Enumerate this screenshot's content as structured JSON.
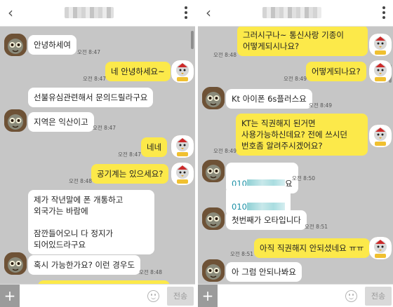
{
  "left": {
    "messages": [
      {
        "text": "안녕하세여"
      },
      {
        "text": "네 안녕하세요~"
      },
      {
        "text": "선불유심관련해서 문의드릴라구요"
      },
      {
        "text": "지역은 익산이고"
      },
      {
        "text": "네네"
      },
      {
        "text": "공기계는 있으세요?"
      },
      {
        "text": "제가 작년말에 폰 개통하고\n외국가는 바람에\n\n잠깐들어오니 다 정지가\n되어있드라구요"
      },
      {
        "text": "혹시 가능한가요? 이런 경우도"
      }
    ],
    "times": [
      "오전 8:47",
      "오전 8:47",
      "오전 8:47",
      "오전 8:47",
      "오전 8:48",
      "오전 8:48"
    ]
  },
  "right": {
    "messages": [
      {
        "text": "그러시구나~ 통신사랑 기종이\n어떻게되시나요?"
      },
      {
        "text": "어떻게되나요?"
      },
      {
        "text": "Kt 아이폰 6s플러스요"
      },
      {
        "text": "KT는 직권해지 된거면\n사용가능하신데요? 전에 쓰시던\n번호좀 알려주시겠어요?"
      },
      {
        "prefix": "010",
        "suffix": "요"
      },
      {
        "prefix": "010",
        "suffix": ""
      },
      {
        "text": "첫번째가 오타입니다"
      },
      {
        "text": "아직 직권해지 안되셨네요 ㅠㅠ"
      },
      {
        "text": "아 그럼 안되나봐요"
      }
    ],
    "times": [
      "오전 8:48",
      "오전 8:49",
      "오전 8:49",
      "오전 8:49",
      "오전 8:50",
      "오전 8:51",
      "오전 8:51"
    ]
  },
  "input": {
    "placeholder": "",
    "send_label": "전송",
    "plus_label": "+"
  },
  "colors": {
    "outgoing": "#fce94a",
    "incoming": "#ffffff",
    "background": "#c6c6c6"
  }
}
